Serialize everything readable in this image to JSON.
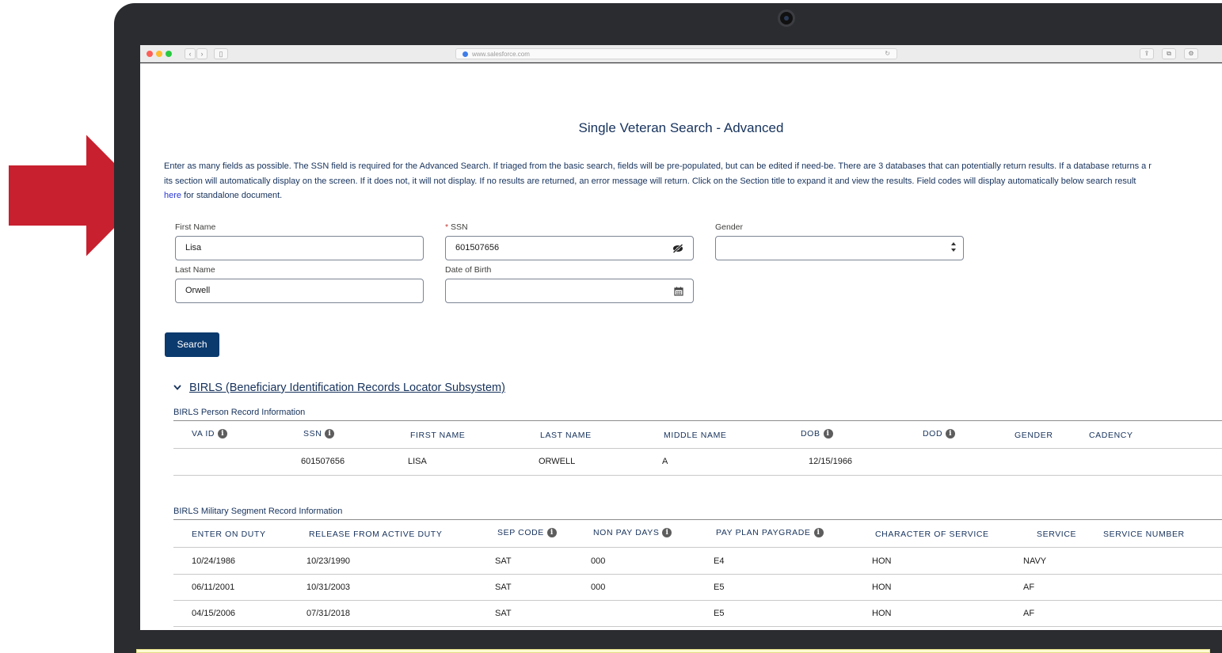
{
  "browser": {
    "url": "www.salesforce.com",
    "back": "‹",
    "forward": "›",
    "sidebar": "▯",
    "reload": "↻"
  },
  "page": {
    "title": "Single Veteran Search - Advanced",
    "intro_line1": "Enter as many fields as possible. The SSN field is required for the Advanced Search. If triaged from the basic search, fields will be pre-populated, but can be edited if need-be. There are 3 databases that can potentially return results. If a database returns a r",
    "intro_line2": "its section will automatically display on the screen. If it does not, it will not display. If no results are returned, an error message will return. Click on the Section title to expand it and view the results. Field codes will display automatically below search result",
    "intro_link": "here",
    "intro_line3_rest": " for standalone document."
  },
  "form": {
    "first_name_label": "First Name",
    "first_name_value": "Lisa",
    "last_name_label": "Last Name",
    "last_name_value": "Orwell",
    "ssn_required_mark": "*",
    "ssn_label": "SSN",
    "ssn_value": "601507656",
    "dob_label": "Date of Birth",
    "dob_value": "",
    "gender_label": "Gender",
    "gender_value": "",
    "search_button": "Search"
  },
  "birls": {
    "section_title": "BIRLS (Beneficiary Identification Records Locator Subsystem)",
    "person_heading": "BIRLS Person Record Information",
    "person_columns": [
      "VA ID",
      "SSN",
      "FIRST NAME",
      "LAST NAME",
      "MIDDLE NAME",
      "DOB",
      "DOD",
      "GENDER",
      "CADENCY"
    ],
    "person_row": [
      "",
      "601507656",
      "LISA",
      "ORWELL",
      "A",
      "12/15/1966",
      "",
      "",
      ""
    ],
    "military_heading": "BIRLS Military Segment Record Information",
    "military_columns": [
      "ENTER ON DUTY",
      "RELEASE FROM ACTIVE DUTY",
      "SEP CODE",
      "NON PAY DAYS",
      "PAY PLAN PAYGRADE",
      "CHARACTER OF SERVICE",
      "SERVICE",
      "SERVICE NUMBER"
    ],
    "military_rows": [
      [
        "10/24/1986",
        "10/23/1990",
        "SAT",
        "000",
        "E4",
        "HON",
        "NAVY",
        ""
      ],
      [
        "06/11/2001",
        "10/31/2003",
        "SAT",
        "000",
        "E5",
        "HON",
        "AF",
        ""
      ],
      [
        "04/15/2006",
        "07/31/2018",
        "SAT",
        "",
        "E5",
        "HON",
        "AF",
        ""
      ]
    ]
  },
  "colors": {
    "arrow": "#c8202e",
    "button": "#0b3a6e",
    "text": "#16325c"
  }
}
